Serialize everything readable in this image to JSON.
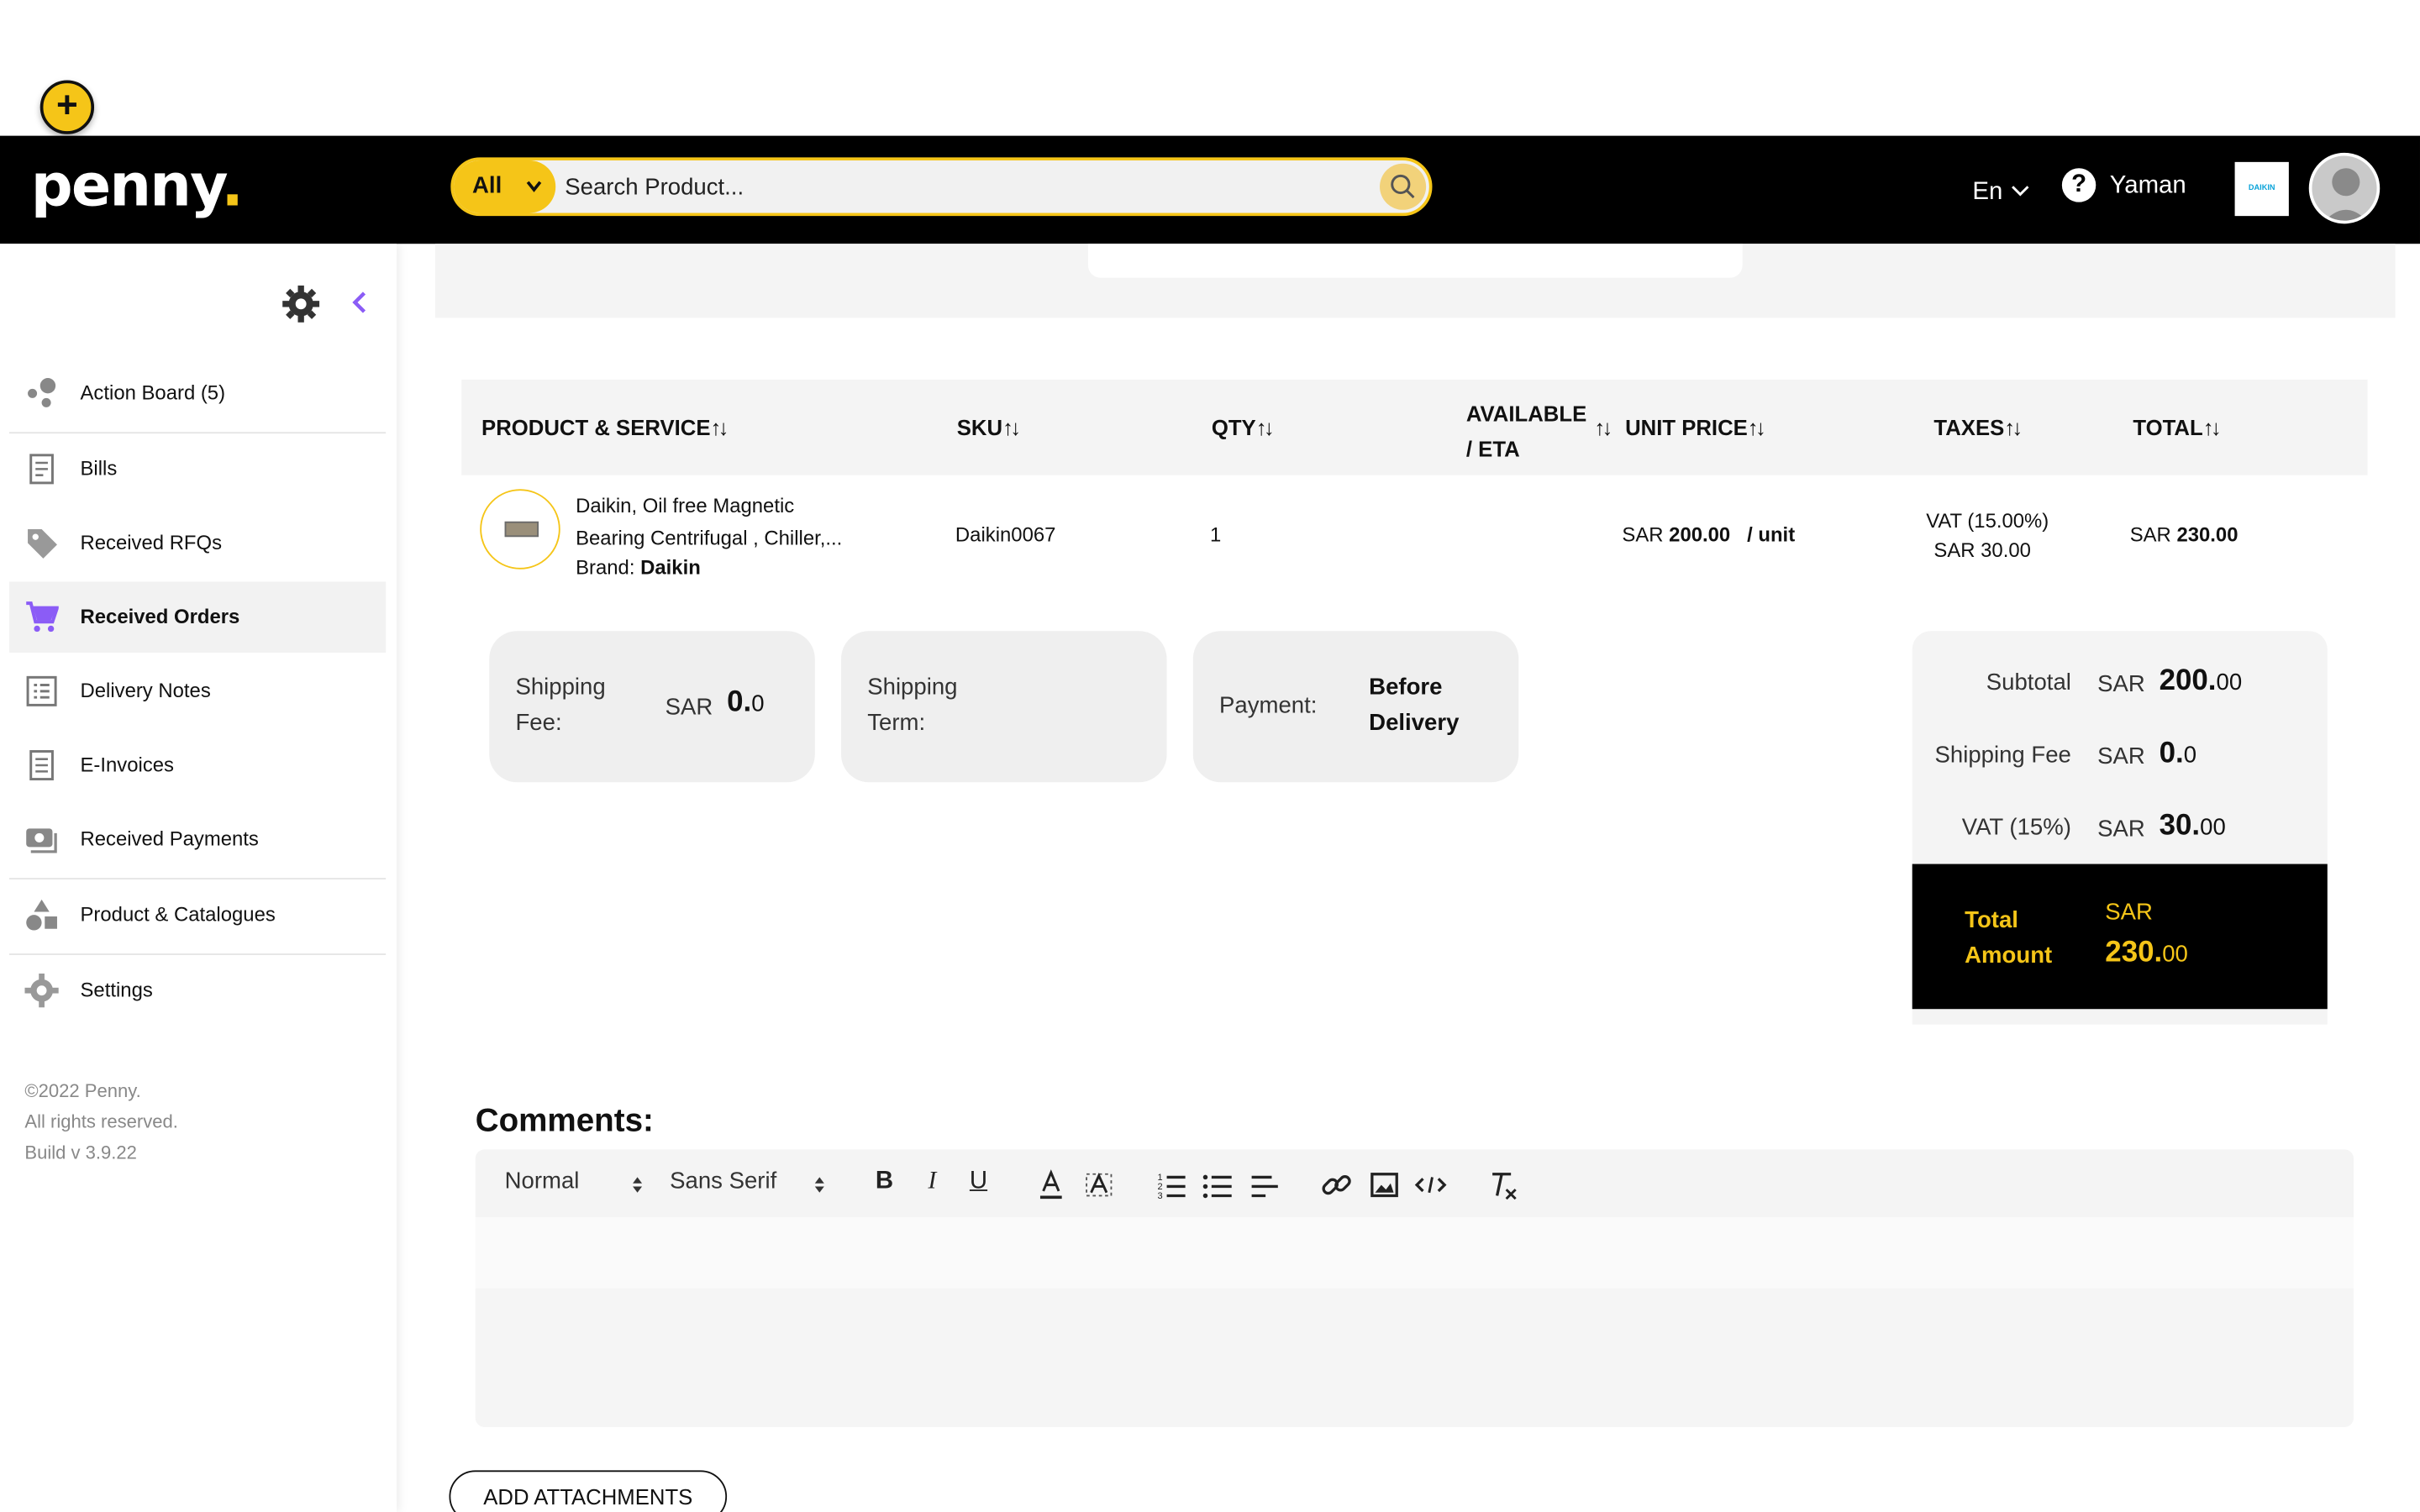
{
  "header": {
    "logo_text": "penny",
    "logo_dot": ".",
    "plus_label": "+",
    "search_scope": "All",
    "search_placeholder": "Search Product...",
    "language": "En",
    "user_name": "Yaman",
    "company_logo_text": "DAIKIN"
  },
  "sidebar": {
    "items": [
      {
        "label": "Action Board (5)",
        "icon": "action-board-icon"
      },
      {
        "label": "Bills",
        "icon": "bills-icon"
      },
      {
        "label": "Received RFQs",
        "icon": "tag-icon"
      },
      {
        "label": "Received Orders",
        "icon": "cart-icon"
      },
      {
        "label": "Delivery Notes",
        "icon": "list-icon"
      },
      {
        "label": "E-Invoices",
        "icon": "invoice-icon"
      },
      {
        "label": "Received Payments",
        "icon": "money-icon"
      },
      {
        "label": "Product & Catalogues",
        "icon": "shapes-icon"
      },
      {
        "label": "Settings",
        "icon": "gear-icon"
      }
    ],
    "footer": [
      "©2022 Penny.",
      "All rights reserved.",
      "Build v 3.9.22"
    ],
    "colors": {
      "active_icon": "#8b5cf6",
      "accent": "#f5c518"
    }
  },
  "table": {
    "headers": {
      "product": "PRODUCT & SERVICE",
      "sku": "SKU",
      "qty": "QTY",
      "available_1": "AVAILABLE",
      "available_2": "/ ETA",
      "unit_price": "UNIT PRICE",
      "taxes": "TAXES",
      "total": "TOTAL",
      "sort_glyph": "↑↓"
    },
    "row": {
      "name_line1": "Daikin, Oil free Magnetic",
      "name_line2": "Bearing Centrifugal , Chiller,...",
      "brand_label": "Brand:",
      "brand": "Daikin",
      "sku": "Daikin0067",
      "qty": "1",
      "unit_price_cur": "SAR",
      "unit_price": "200.00",
      "unit": "/ unit",
      "tax_name": "VAT  (15.00%)",
      "tax_amount": "SAR  30.00",
      "total_cur": "SAR",
      "total": "230.00"
    }
  },
  "pills": {
    "shipping_fee_label_1": "Shipping",
    "shipping_fee_label_2": "Fee:",
    "shipping_fee_cur": "SAR",
    "shipping_fee_int": "0.",
    "shipping_fee_dec": "0",
    "shipping_term_label_1": "Shipping",
    "shipping_term_label_2": "Term:",
    "payment_label": "Payment:",
    "payment_value_1": "Before",
    "payment_value_2": "Delivery"
  },
  "summary": {
    "subtotal_label": "Subtotal",
    "subtotal_cur": "SAR",
    "subtotal_int": "200.",
    "subtotal_dec": "00",
    "shipping_label": "Shipping Fee",
    "shipping_cur": "SAR",
    "shipping_int": "0.",
    "shipping_dec": "0",
    "vat_label": "VAT (15%)",
    "vat_cur": "SAR",
    "vat_int": "30.",
    "vat_dec": "00",
    "total_label_1": "Total",
    "total_label_2": "Amount",
    "total_cur": "SAR",
    "total_int": "230.",
    "total_dec": "00"
  },
  "comments": {
    "title": "Comments:",
    "format_select": "Normal",
    "font_select": "Sans Serif"
  },
  "attach_label": "ADD ATTACHMENTS"
}
